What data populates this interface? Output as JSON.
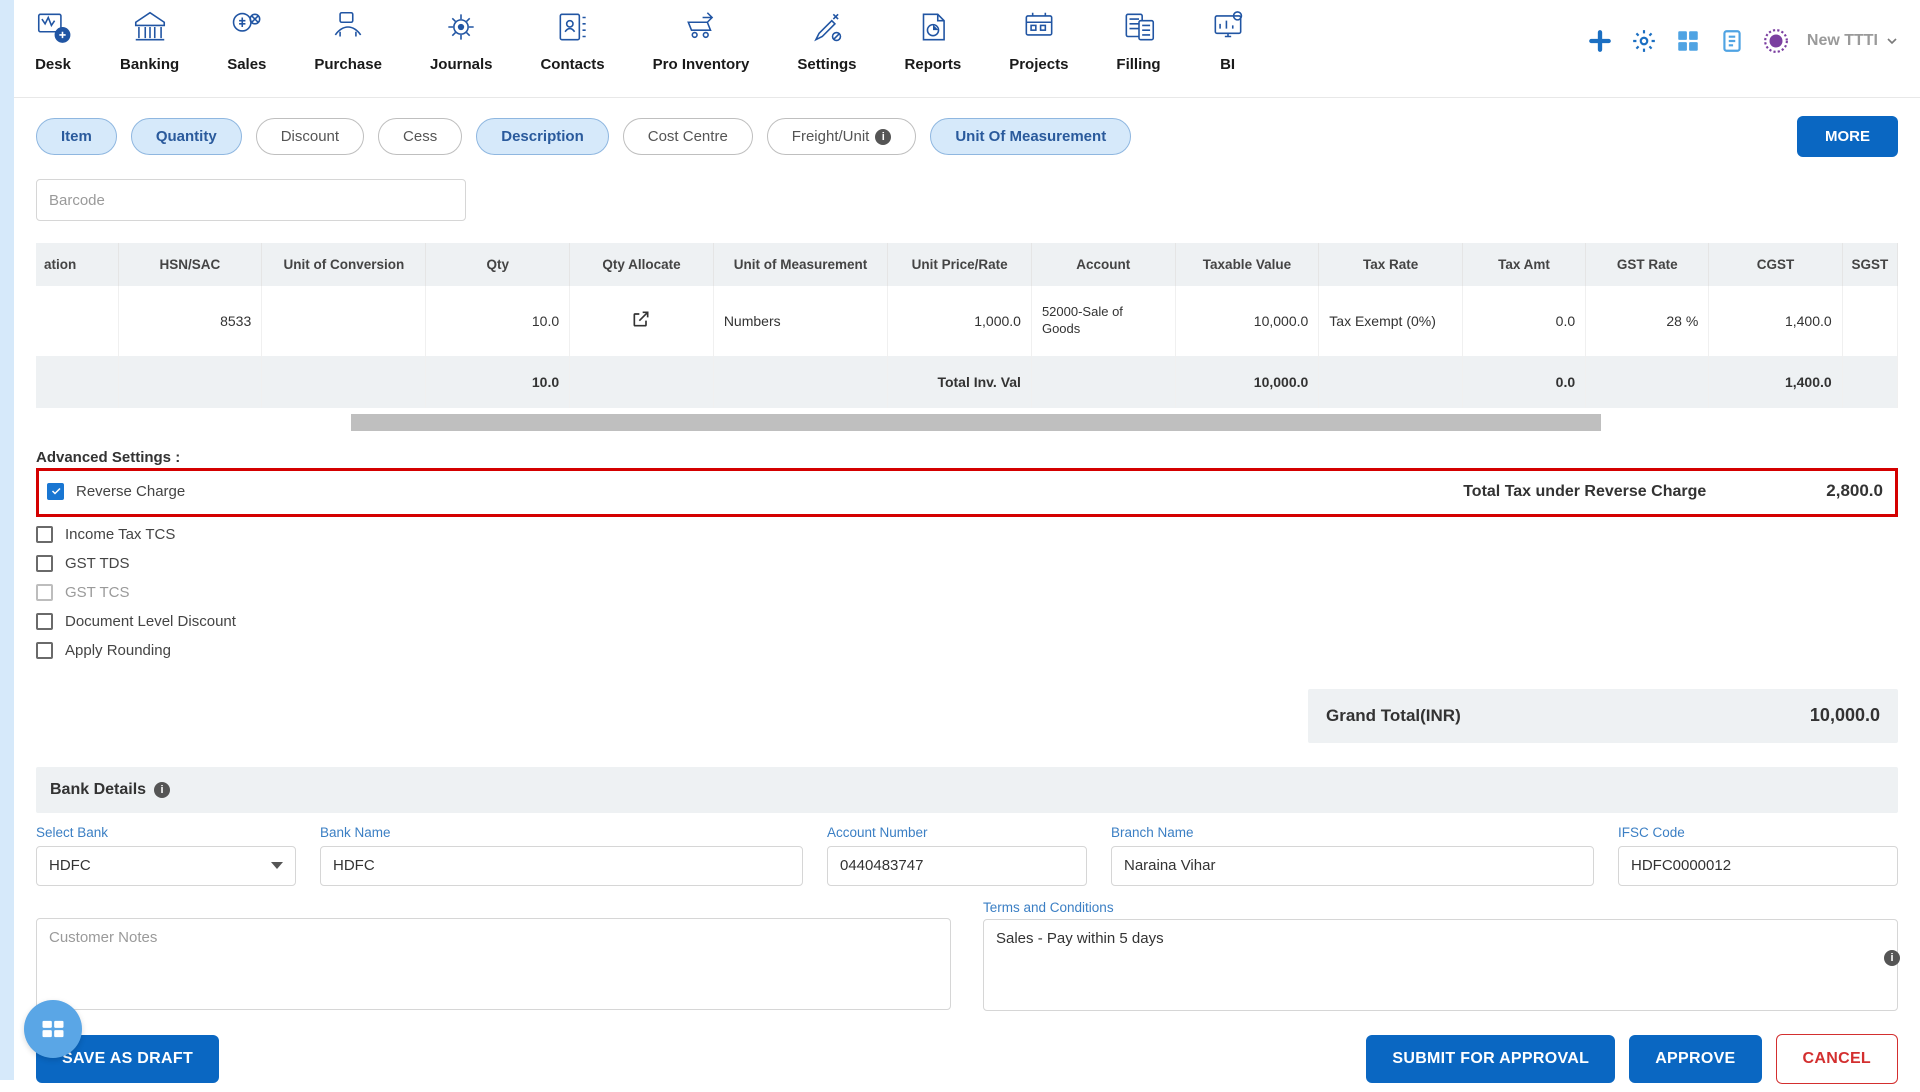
{
  "nav": {
    "items": [
      {
        "label": "Desk"
      },
      {
        "label": "Banking"
      },
      {
        "label": "Sales"
      },
      {
        "label": "Purchase"
      },
      {
        "label": "Journals"
      },
      {
        "label": "Contacts"
      },
      {
        "label": "Pro Inventory"
      },
      {
        "label": "Settings"
      },
      {
        "label": "Reports"
      },
      {
        "label": "Projects"
      },
      {
        "label": "Filling"
      },
      {
        "label": "BI"
      }
    ],
    "company": "New TTTI"
  },
  "pills": {
    "item": "Item",
    "quantity": "Quantity",
    "discount": "Discount",
    "cess": "Cess",
    "description": "Description",
    "cost_centre": "Cost Centre",
    "freight": "Freight/Unit",
    "uom": "Unit Of Measurement",
    "more": "MORE"
  },
  "barcode_placeholder": "Barcode",
  "grid": {
    "headers": {
      "ation": "ation",
      "hsn": "HSN/SAC",
      "uoc": "Unit of Conversion",
      "qty": "Qty",
      "qtyalloc": "Qty Allocate",
      "uom": "Unit of Measurement",
      "rate": "Unit Price/Rate",
      "account": "Account",
      "taxable": "Taxable Value",
      "taxrate": "Tax Rate",
      "taxamt": "Tax Amt",
      "gstrate": "GST Rate",
      "cgst": "CGST",
      "sgst": "SGST"
    },
    "row": {
      "hsn": "8533",
      "qty": "10.0",
      "uom": "Numbers",
      "rate": "1,000.0",
      "account": "52000-Sale of Goods",
      "taxable": "10,000.0",
      "taxrate": "Tax Exempt (0%)",
      "taxamt": "0.0",
      "gstrate": "28 %",
      "cgst": "1,400.0"
    },
    "totals": {
      "qty": "10.0",
      "inv_label": "Total Inv. Val",
      "taxable": "10,000.0",
      "taxamt": "0.0",
      "cgst": "1,400.0"
    }
  },
  "adv": {
    "title": "Advanced Settings :",
    "reverse_charge": "Reverse Charge",
    "income_tcs": "Income Tax TCS",
    "gst_tds": "GST TDS",
    "gst_tcs": "GST TCS",
    "doc_disc": "Document Level Discount",
    "rounding": "Apply Rounding",
    "rc_total_label": "Total Tax under Reverse Charge",
    "rc_total_value": "2,800.0"
  },
  "grand_total": {
    "label": "Grand Total(INR)",
    "value": "10,000.0"
  },
  "bank": {
    "header": "Bank Details",
    "select_label": "Select Bank",
    "select_value": "HDFC",
    "name_label": "Bank Name",
    "name_value": "HDFC",
    "acct_label": "Account Number",
    "acct_value": "0440483747",
    "branch_label": "Branch Name",
    "branch_value": "Naraina Vihar",
    "ifsc_label": "IFSC Code",
    "ifsc_value": "HDFC0000012"
  },
  "notes": {
    "placeholder": "Customer Notes",
    "terms_label": "Terms and Conditions",
    "terms_value": "Sales - Pay within 5 days"
  },
  "actions": {
    "draft": "SAVE AS DRAFT",
    "submit": "SUBMIT FOR APPROVAL",
    "approve": "APPROVE",
    "cancel": "CANCEL"
  }
}
